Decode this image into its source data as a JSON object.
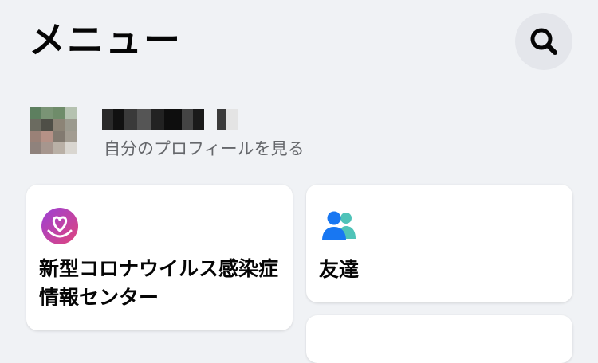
{
  "header": {
    "title": "メニュー",
    "search_icon": "search-icon"
  },
  "profile": {
    "name": "",
    "subtitle": "自分のプロフィールを見る"
  },
  "shortcuts": [
    {
      "label": "新型コロナウイルス感染症情報センター",
      "icon": "heart-hands-icon",
      "icon_color": "#c13584"
    },
    {
      "label": "友達",
      "icon": "friends-icon",
      "icon_color": "#1877f2"
    }
  ],
  "colors": {
    "background": "#f0f2f5",
    "card": "#ffffff",
    "search_button": "#e4e6eb",
    "secondary_text": "#65676b"
  }
}
